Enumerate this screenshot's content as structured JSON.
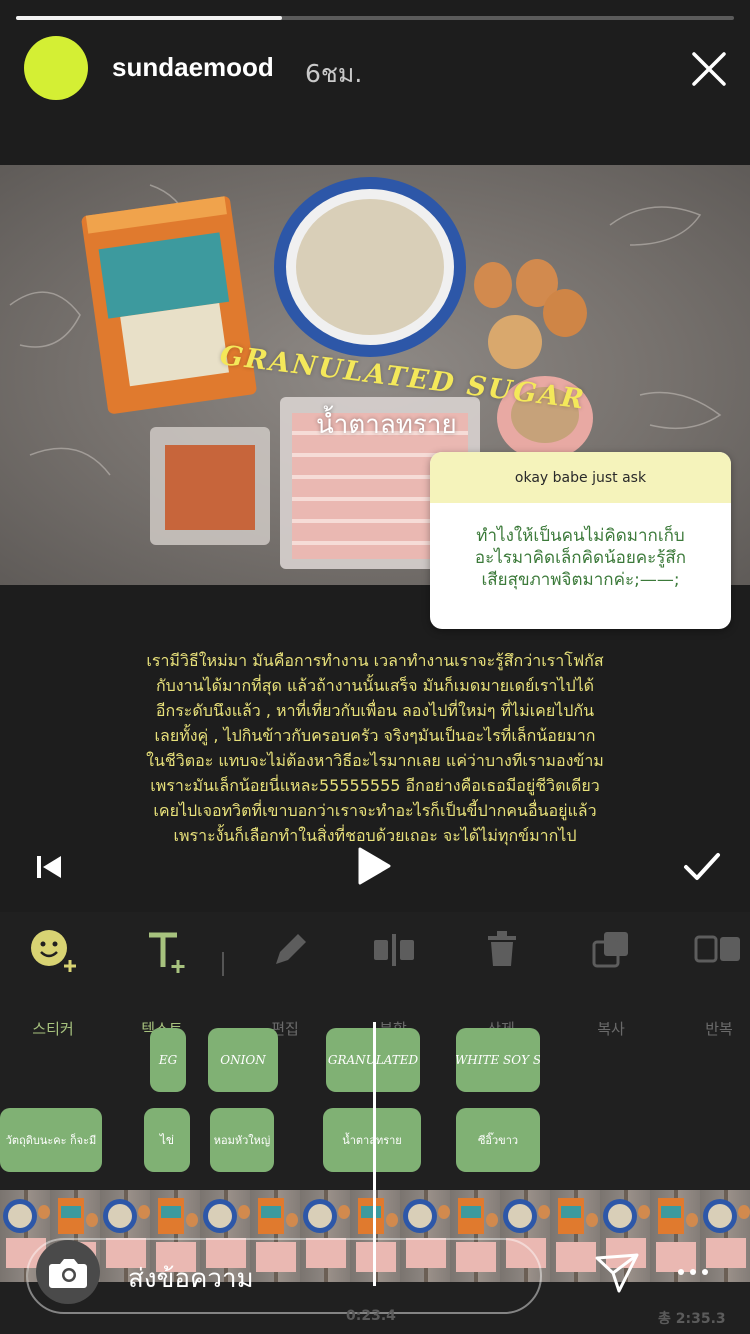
{
  "story": {
    "progress": 0.37,
    "username": "sundaemood",
    "time": "6ชม.",
    "avatar_color": "#d4ef34"
  },
  "video": {
    "overlay_en": "GRANULATED SUGAR",
    "overlay_th": "น้ำตาลทราย"
  },
  "question": {
    "prompt": "okay babe just ask",
    "lines": [
      "ทำไงให้เป็นคนไม่คิดมากเก็บ",
      "อะไรมาคิดเล็กคิดน้อยคะรู้สึก",
      "เสียสุขภาพจิตมากค่ะ;——;"
    ]
  },
  "caption": [
    "เรามีวิธีใหม่มา มันคือการทำงาน เวลาทำงานเราจะรู้สึกว่าเราโฟกัส",
    "กับงานได้มากที่สุด แล้วถ้างานนั้นเสร็จ มันก็เมดมายเดย์เราไปได้",
    "อีกระดับนึงแล้ว , หาที่เที่ยวกับเพื่อน ลองไปที่ใหม่ๆ ที่ไม่เคยไปกัน",
    "เลยทั้งคู่ , ไปกินข้าวกับครอบครัว จริงๆมันเป็นอะไรที่เล็กน้อยมาก",
    "ในชีวิตอะ แทบจะไม่ต้องหาวิธีอะไรมากเลย แค่ว่าบางทีเรามองข้าม",
    "เพราะมันเล็กน้อยนี่แหละ55555555 อีกอย่างคือเธอมีอยู่ชีวิตเดียว",
    "เคยไปเจอทวิตที่เขาบอกว่าเราจะทำอะไรก็เป็นขี้ปากคนอื่นอยู่แล้ว",
    "เพราะงั้นก็เลือกทำในสิ่งที่ชอบด้วยเถอะ จะได้ไม่ทุกข์มากไป"
  ],
  "tools": {
    "sticker": "스티커",
    "text": "텍스트",
    "edit": "편집",
    "split": "분할",
    "delete": "삭제",
    "copy": "복사",
    "repeat": "반복"
  },
  "chips": {
    "row1": [
      "EG",
      "ONION",
      "GRANULATED",
      "WHITE SOY S"
    ],
    "row2": [
      "วัตถุดิบนะคะ ก็จะมี",
      "ไข่",
      "หอมหัวใหญ่",
      "น้ำตาลทราย",
      "ซีอิ๊วขาว"
    ]
  },
  "message": {
    "placeholder": "ส่งข้อความ"
  },
  "timecodes": {
    "current": "0:23.4",
    "total": "총 2:35.3"
  },
  "colors": {
    "accent_green": "#80b174",
    "caption_yellow": "#e7e07a",
    "sticker_yellow": "#f5f3bb"
  }
}
